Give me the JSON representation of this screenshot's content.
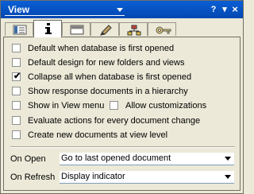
{
  "window": {
    "title": "View",
    "buttons": {
      "help": "?",
      "minimize": "▾",
      "close": "×"
    }
  },
  "tabs": [
    {
      "icon": "properties-icon"
    },
    {
      "icon": "info-icon",
      "active": true
    },
    {
      "icon": "layout-icon"
    },
    {
      "icon": "pen-icon"
    },
    {
      "icon": "hierarchy-icon"
    },
    {
      "icon": "key-icon"
    }
  ],
  "options": [
    {
      "label": "Default when database is first opened",
      "checked": false
    },
    {
      "label": "Default design for new folders and views",
      "checked": false
    },
    {
      "label": "Collapse all when database is first opened",
      "checked": true,
      "mark": "✔"
    },
    {
      "label": "Show response documents in a hierarchy",
      "checked": false
    },
    {
      "label": "Show in View menu",
      "checked": false
    },
    {
      "label": "Allow customizations",
      "checked": false
    },
    {
      "label": "Evaluate actions for every document change",
      "checked": false
    },
    {
      "label": "Create new documents at view level",
      "checked": false
    }
  ],
  "on_open": {
    "label": "On Open",
    "value": "Go to last opened document"
  },
  "on_refresh": {
    "label": "On Refresh",
    "value": "Display indicator"
  },
  "colors": {
    "titlebar": "#0a5fd6",
    "panel": "#ece9d8"
  }
}
